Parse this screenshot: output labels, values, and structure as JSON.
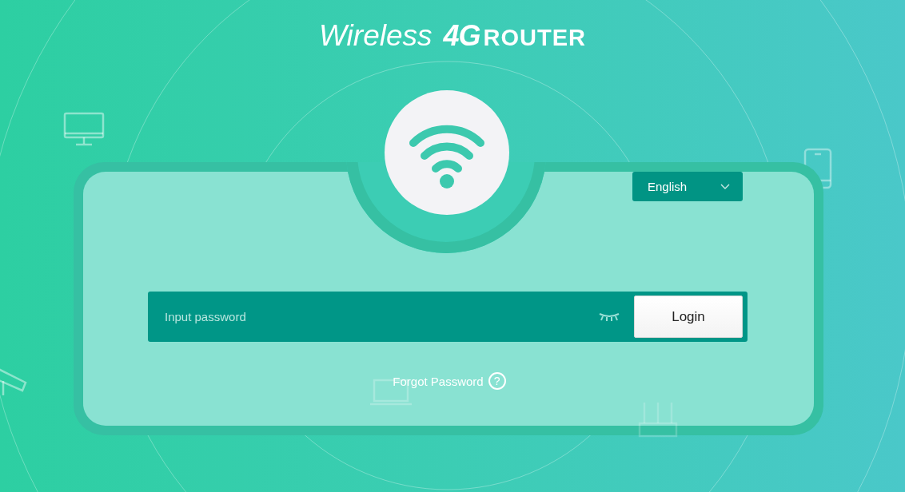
{
  "logo": {
    "wireless": "Wireless",
    "generation": "4G",
    "product": "ROUTER"
  },
  "language": {
    "value": "English"
  },
  "password": {
    "placeholder": "Input password",
    "visible": false
  },
  "login_button": "Login",
  "forgot_link": "Forgot Password",
  "help_mark": "?"
}
